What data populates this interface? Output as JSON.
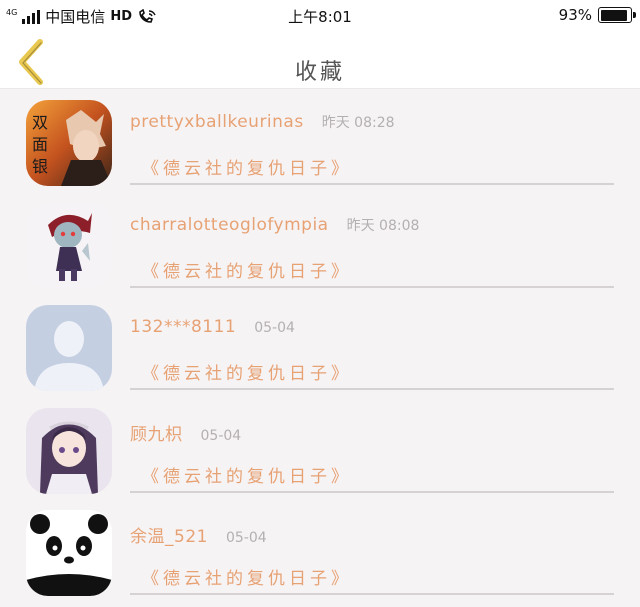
{
  "status_bar": {
    "network_type": "4G",
    "carrier": "中国电信",
    "hd": "HD",
    "time": "上午8:01",
    "battery_percent": "93%",
    "battery_level": 0.93
  },
  "nav": {
    "title": "收藏",
    "back_icon": "chevron-left-icon",
    "accent_color": "#e8c84f"
  },
  "favorites": [
    {
      "username": "prettyxballkeurinas",
      "time": "昨天 08:28",
      "title": "《德云社的复仇日子》",
      "avatar": "anime-character-avatar"
    },
    {
      "username": "charralotteoglofympia",
      "time": "昨天 08:08",
      "title": "《德云社的复仇日子》",
      "avatar": "game-figure-avatar"
    },
    {
      "username": "132***8111",
      "time": "05-04",
      "title": "《德云社的复仇日子》",
      "avatar": "default-user-avatar"
    },
    {
      "username": "顾九枳",
      "time": "05-04",
      "title": "《德云社的复仇日子》",
      "avatar": "anime-girl-avatar"
    },
    {
      "username": "余温_521",
      "time": "05-04",
      "title": "《德云社的复仇日子》",
      "avatar": "panda-avatar"
    }
  ]
}
